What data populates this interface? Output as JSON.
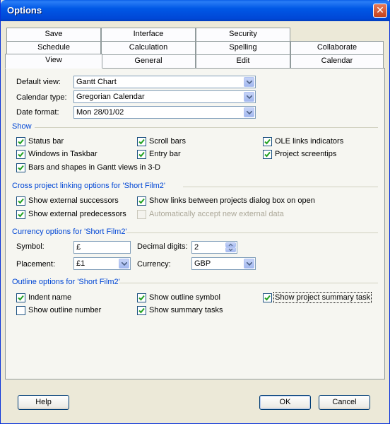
{
  "window": {
    "title": "Options"
  },
  "tabs": {
    "row1": [
      "Save",
      "Interface",
      "Security"
    ],
    "row2": [
      "Schedule",
      "Calculation",
      "Spelling",
      "Collaborate"
    ],
    "row3": [
      "View",
      "General",
      "Edit",
      "Calendar"
    ],
    "active": "View"
  },
  "view_settings": {
    "default_view_label": "Default view:",
    "default_view_value": "Gantt Chart",
    "calendar_type_label": "Calendar type:",
    "calendar_type_value": "Gregorian Calendar",
    "date_format_label": "Date format:",
    "date_format_value": "Mon 28/01/02"
  },
  "show": {
    "title": "Show",
    "status_bar": {
      "label": "Status bar",
      "checked": true
    },
    "scroll_bars": {
      "label": "Scroll bars",
      "checked": true
    },
    "ole_links": {
      "label": "OLE links indicators",
      "checked": true
    },
    "windows_taskbar": {
      "label": "Windows in Taskbar",
      "checked": true
    },
    "entry_bar": {
      "label": "Entry bar",
      "checked": true
    },
    "screentips": {
      "label": "Project screentips",
      "checked": true
    },
    "bars_3d": {
      "label": "Bars and shapes in Gantt views in 3-D",
      "checked": true
    }
  },
  "cross_project": {
    "title": "Cross project linking options for 'Short Film2'",
    "ext_successors": {
      "label": "Show external successors",
      "checked": true
    },
    "show_links_dialog": {
      "label": "Show links between projects dialog box on open",
      "checked": true
    },
    "ext_predecessors": {
      "label": "Show external predecessors",
      "checked": true
    },
    "auto_accept": {
      "label": "Automatically accept new external data",
      "checked": false,
      "disabled": true
    }
  },
  "currency": {
    "title": "Currency options for 'Short Film2'",
    "symbol_label": "Symbol:",
    "symbol_value": "£",
    "decimal_label": "Decimal digits:",
    "decimal_value": "2",
    "placement_label": "Placement:",
    "placement_value": "£1",
    "currency_label": "Currency:",
    "currency_value": "GBP"
  },
  "outline": {
    "title": "Outline options for 'Short Film2'",
    "indent_name": {
      "label": "Indent name",
      "checked": true
    },
    "show_outline_symbol": {
      "label": "Show outline symbol",
      "checked": true
    },
    "show_project_summary": {
      "label": "Show project summary task",
      "checked": true
    },
    "show_outline_number": {
      "label": "Show outline number",
      "checked": false
    },
    "show_summary_tasks": {
      "label": "Show summary tasks",
      "checked": true
    }
  },
  "buttons": {
    "help": "Help",
    "ok": "OK",
    "cancel": "Cancel"
  }
}
